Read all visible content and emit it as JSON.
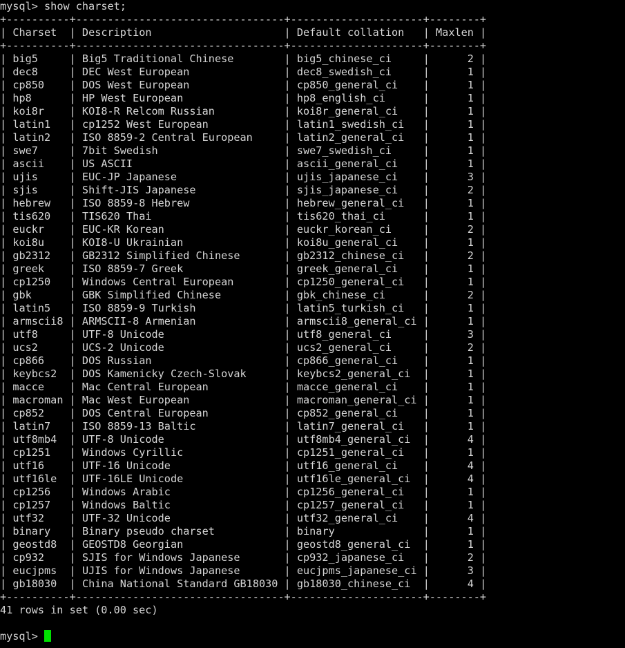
{
  "terminal": {
    "prompt": "mysql>",
    "command": "show charset;",
    "columns": [
      "Charset",
      "Description",
      "Default collation",
      "Maxlen"
    ],
    "rows": [
      [
        "big5",
        "Big5 Traditional Chinese",
        "big5_chinese_ci",
        "2"
      ],
      [
        "dec8",
        "DEC West European",
        "dec8_swedish_ci",
        "1"
      ],
      [
        "cp850",
        "DOS West European",
        "cp850_general_ci",
        "1"
      ],
      [
        "hp8",
        "HP West European",
        "hp8_english_ci",
        "1"
      ],
      [
        "koi8r",
        "KOI8-R Relcom Russian",
        "koi8r_general_ci",
        "1"
      ],
      [
        "latin1",
        "cp1252 West European",
        "latin1_swedish_ci",
        "1"
      ],
      [
        "latin2",
        "ISO 8859-2 Central European",
        "latin2_general_ci",
        "1"
      ],
      [
        "swe7",
        "7bit Swedish",
        "swe7_swedish_ci",
        "1"
      ],
      [
        "ascii",
        "US ASCII",
        "ascii_general_ci",
        "1"
      ],
      [
        "ujis",
        "EUC-JP Japanese",
        "ujis_japanese_ci",
        "3"
      ],
      [
        "sjis",
        "Shift-JIS Japanese",
        "sjis_japanese_ci",
        "2"
      ],
      [
        "hebrew",
        "ISO 8859-8 Hebrew",
        "hebrew_general_ci",
        "1"
      ],
      [
        "tis620",
        "TIS620 Thai",
        "tis620_thai_ci",
        "1"
      ],
      [
        "euckr",
        "EUC-KR Korean",
        "euckr_korean_ci",
        "2"
      ],
      [
        "koi8u",
        "KOI8-U Ukrainian",
        "koi8u_general_ci",
        "1"
      ],
      [
        "gb2312",
        "GB2312 Simplified Chinese",
        "gb2312_chinese_ci",
        "2"
      ],
      [
        "greek",
        "ISO 8859-7 Greek",
        "greek_general_ci",
        "1"
      ],
      [
        "cp1250",
        "Windows Central European",
        "cp1250_general_ci",
        "1"
      ],
      [
        "gbk",
        "GBK Simplified Chinese",
        "gbk_chinese_ci",
        "2"
      ],
      [
        "latin5",
        "ISO 8859-9 Turkish",
        "latin5_turkish_ci",
        "1"
      ],
      [
        "armscii8",
        "ARMSCII-8 Armenian",
        "armscii8_general_ci",
        "1"
      ],
      [
        "utf8",
        "UTF-8 Unicode",
        "utf8_general_ci",
        "3"
      ],
      [
        "ucs2",
        "UCS-2 Unicode",
        "ucs2_general_ci",
        "2"
      ],
      [
        "cp866",
        "DOS Russian",
        "cp866_general_ci",
        "1"
      ],
      [
        "keybcs2",
        "DOS Kamenicky Czech-Slovak",
        "keybcs2_general_ci",
        "1"
      ],
      [
        "macce",
        "Mac Central European",
        "macce_general_ci",
        "1"
      ],
      [
        "macroman",
        "Mac West European",
        "macroman_general_ci",
        "1"
      ],
      [
        "cp852",
        "DOS Central European",
        "cp852_general_ci",
        "1"
      ],
      [
        "latin7",
        "ISO 8859-13 Baltic",
        "latin7_general_ci",
        "1"
      ],
      [
        "utf8mb4",
        "UTF-8 Unicode",
        "utf8mb4_general_ci",
        "4"
      ],
      [
        "cp1251",
        "Windows Cyrillic",
        "cp1251_general_ci",
        "1"
      ],
      [
        "utf16",
        "UTF-16 Unicode",
        "utf16_general_ci",
        "4"
      ],
      [
        "utf16le",
        "UTF-16LE Unicode",
        "utf16le_general_ci",
        "4"
      ],
      [
        "cp1256",
        "Windows Arabic",
        "cp1256_general_ci",
        "1"
      ],
      [
        "cp1257",
        "Windows Baltic",
        "cp1257_general_ci",
        "1"
      ],
      [
        "utf32",
        "UTF-32 Unicode",
        "utf32_general_ci",
        "4"
      ],
      [
        "binary",
        "Binary pseudo charset",
        "binary",
        "1"
      ],
      [
        "geostd8",
        "GEOSTD8 Georgian",
        "geostd8_general_ci",
        "1"
      ],
      [
        "cp932",
        "SJIS for Windows Japanese",
        "cp932_japanese_ci",
        "2"
      ],
      [
        "eucjpms",
        "UJIS for Windows Japanese",
        "eucjpms_japanese_ci",
        "3"
      ],
      [
        "gb18030",
        "China National Standard GB18030",
        "gb18030_chinese_ci",
        "4"
      ]
    ],
    "result_summary": "41 rows in set (0.00 sec)",
    "cursor_color": "#00e000",
    "text_color": "#d6d6d6",
    "background_color": "#000000"
  }
}
